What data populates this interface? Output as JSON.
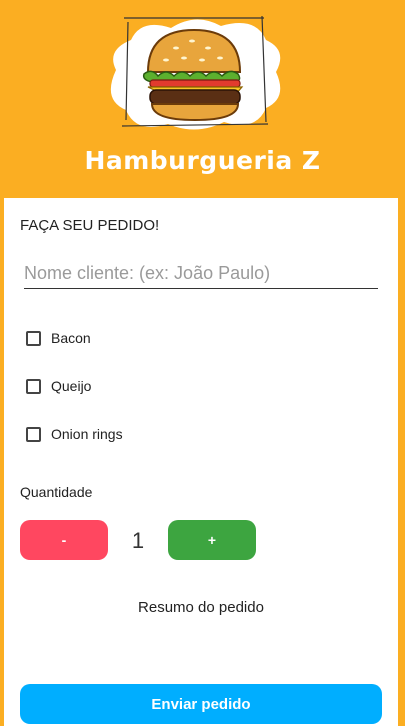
{
  "header": {
    "title": "Hamburgueria Z",
    "logo_icon": "burger-icon"
  },
  "form": {
    "heading": "FAÇA SEU PEDIDO!",
    "name_placeholder": "Nome cliente: (ex: João Paulo)",
    "name_value": "",
    "options": [
      {
        "label": "Bacon",
        "checked": false
      },
      {
        "label": "Queijo",
        "checked": false
      },
      {
        "label": "Onion rings",
        "checked": false
      }
    ],
    "quantity_label": "Quantidade",
    "minus_label": "-",
    "plus_label": "+",
    "quantity_value": "1",
    "summary_label": "Resumo do pedido",
    "submit_label": "Enviar pedido"
  },
  "colors": {
    "background": "#FBAE22",
    "minus_button": "#FF4760",
    "plus_button": "#3DA540",
    "submit_button": "#00AEFF"
  }
}
